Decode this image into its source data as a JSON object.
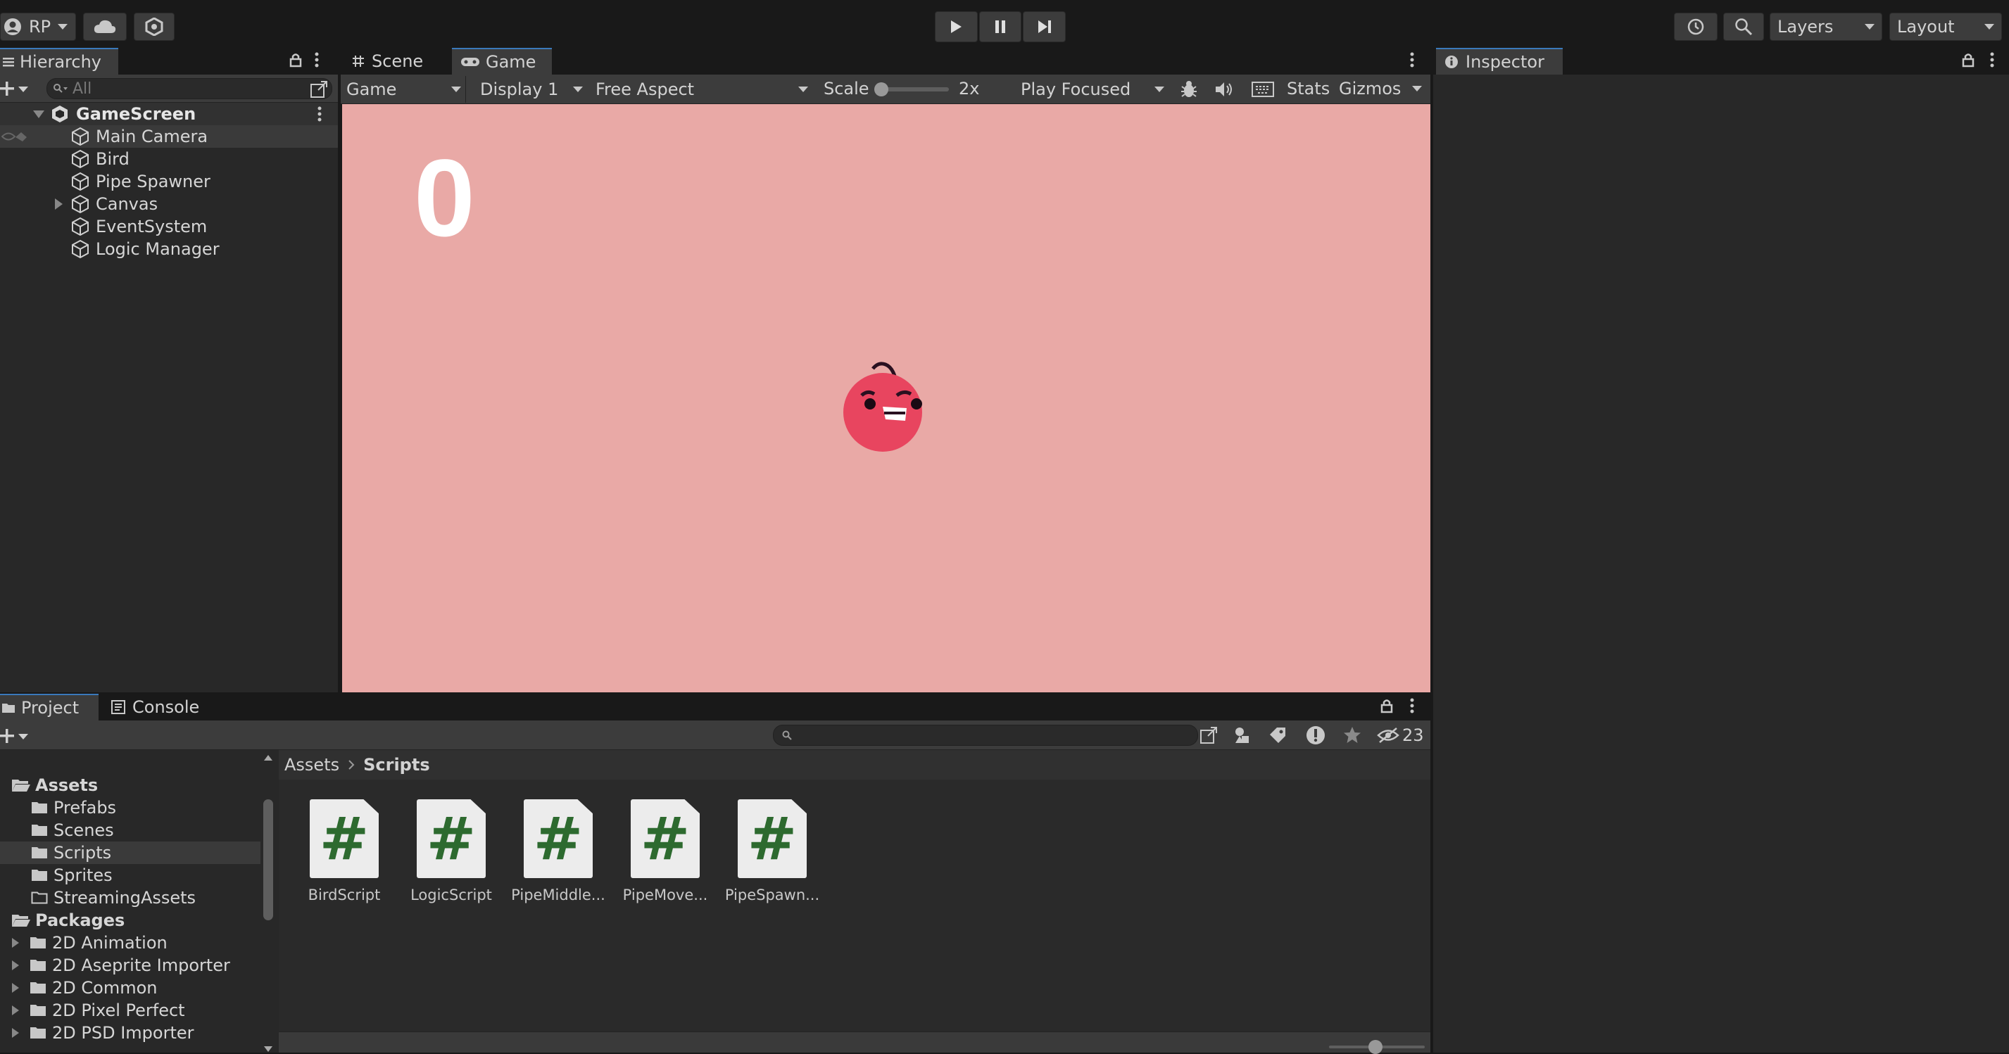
{
  "toolbar": {
    "account_label": "RP",
    "layers_label": "Layers",
    "layout_label": "Layout"
  },
  "hierarchy": {
    "tab_label": "Hierarchy",
    "search_placeholder": "All",
    "scene_name": "GameScreen",
    "items": [
      {
        "label": "Main Camera"
      },
      {
        "label": "Bird"
      },
      {
        "label": "Pipe Spawner"
      },
      {
        "label": "Canvas"
      },
      {
        "label": "EventSystem"
      },
      {
        "label": "Logic Manager"
      }
    ]
  },
  "game_view": {
    "tabs": [
      {
        "label": "Scene"
      },
      {
        "label": "Game"
      }
    ],
    "mode_dropdown": "Game",
    "display_dropdown": "Display 1",
    "aspect_dropdown": "Free Aspect",
    "scale_label": "Scale",
    "scale_value": "2x",
    "play_mode_dropdown": "Play Focused",
    "stats_label": "Stats",
    "gizmos_label": "Gizmos",
    "score": "0",
    "background_color": "#e9a9a6",
    "bird_color": "#e8455f"
  },
  "inspector": {
    "tab_label": "Inspector"
  },
  "project": {
    "tabs": [
      {
        "label": "Project"
      },
      {
        "label": "Console"
      }
    ],
    "hidden_count": "23",
    "breadcrumb": [
      "Assets",
      "Scripts"
    ],
    "tree": [
      {
        "label": "Assets"
      },
      {
        "label": "Prefabs"
      },
      {
        "label": "Scenes"
      },
      {
        "label": "Scripts"
      },
      {
        "label": "Sprites"
      },
      {
        "label": "StreamingAssets"
      },
      {
        "label": "Packages"
      },
      {
        "label": "2D Animation"
      },
      {
        "label": "2D Aseprite Importer"
      },
      {
        "label": "2D Common"
      },
      {
        "label": "2D Pixel Perfect"
      },
      {
        "label": "2D PSD Importer"
      }
    ],
    "assets": [
      {
        "name": "BirdScript"
      },
      {
        "name": "LogicScript"
      },
      {
        "name": "PipeMiddle..."
      },
      {
        "name": "PipeMove..."
      },
      {
        "name": "PipeSpawn..."
      }
    ]
  }
}
